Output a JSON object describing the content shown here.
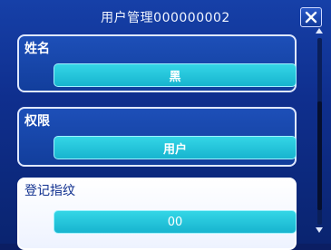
{
  "window": {
    "title": "用户管理000000002",
    "close_icon": "close-x-icon"
  },
  "fields": {
    "name": {
      "label": "姓名",
      "value": "黑"
    },
    "permission": {
      "label": "权限",
      "value": "用户"
    },
    "fingerprint": {
      "label": "登记指纹",
      "value": "00"
    }
  },
  "scrollbar": {
    "up_icon": "scroll-up-arrow-icon",
    "down_icon": "scroll-down-arrow-icon"
  },
  "colors": {
    "background": "#0f2f8e",
    "field_accent": "#17b4cf",
    "card_border": "#dfe8ff",
    "selected_card": "#ffffff"
  }
}
